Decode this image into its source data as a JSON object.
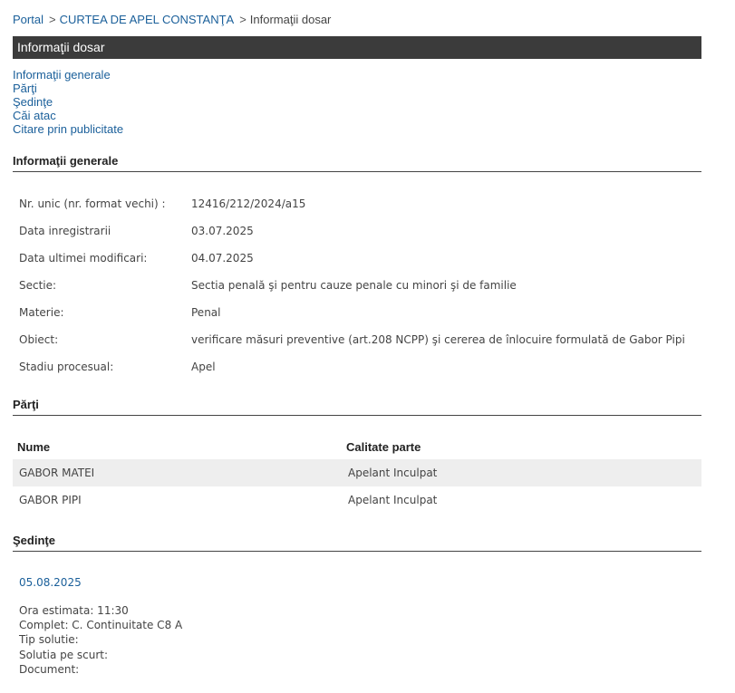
{
  "breadcrumb": {
    "portal": "Portal",
    "court": "CURTEA DE APEL CONSTANŢA",
    "current": "Informaţii dosar",
    "separator": ">"
  },
  "title": "Informaţii dosar",
  "nav": [
    "Informaţii generale",
    "Părţi",
    "Şedinţe",
    "Căi atac",
    "Citare prin publicitate"
  ],
  "sections": {
    "general": "Informaţii generale",
    "parti": "Părţi",
    "sedinte": "Şedinţe"
  },
  "general_info": [
    {
      "label": "Nr. unic (nr. format vechi) :",
      "value": "12416/212/2024/a15"
    },
    {
      "label": "Data inregistrarii",
      "value": "03.07.2025"
    },
    {
      "label": "Data ultimei modificari:",
      "value": "04.07.2025"
    },
    {
      "label": "Sectie:",
      "value": "Sectia penală şi pentru cauze penale cu minori şi de familie"
    },
    {
      "label": "Materie:",
      "value": "Penal"
    },
    {
      "label": "Obiect:",
      "value": "verificare măsuri preventive (art.208 NCPP) şi cererea de înlocuire formulată de Gabor Pipi"
    },
    {
      "label": "Stadiu procesual:",
      "value": "Apel"
    }
  ],
  "parti": {
    "headers": [
      "Nume",
      "Calitate parte"
    ],
    "rows": [
      {
        "nume": "GABOR MATEI",
        "calitate": "Apelant Inculpat"
      },
      {
        "nume": "GABOR PIPI",
        "calitate": "Apelant Inculpat"
      }
    ]
  },
  "sedinta": {
    "date": "05.08.2025",
    "details": [
      "Ora estimata: 11:30",
      "Complet: C. Continuitate C8 A",
      "Tip solutie:",
      "Solutia pe scurt:",
      "Document:"
    ]
  }
}
